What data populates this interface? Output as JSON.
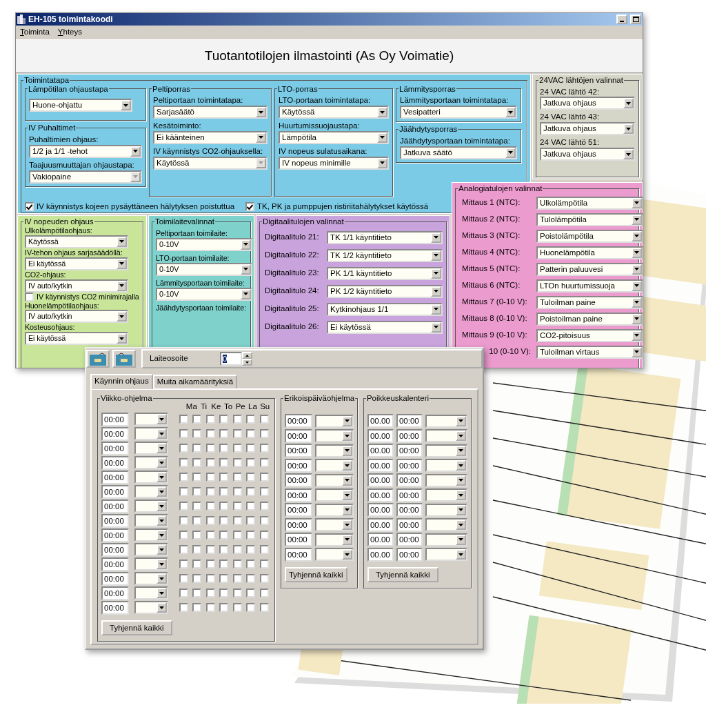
{
  "window": {
    "title": "EH-105 toimintakoodi"
  },
  "menu": [
    "Toiminta",
    "Yhteys"
  ],
  "heading": "Tuotantotilojen ilmastointi (As Oy Voimatie)",
  "toimintatapa": {
    "title": "Toimintatapa",
    "columns": [
      [
        {
          "title": "Lämpötilan ohjaustapa",
          "fields": [
            {
              "value": "Huone-ohjattu",
              "disabled": false
            }
          ]
        },
        {
          "title": "IV Puhaltimet",
          "fields": [
            {
              "label": "Puhaltimien ohjaus:",
              "value": "1/2 ja 1/1 -tehot",
              "disabled": false
            },
            {
              "label": "Taajuusmuuttajan ohjaustapa:",
              "value": "Vakiopaine",
              "disabled": true
            }
          ]
        }
      ],
      [
        {
          "title": "Peltiporras",
          "fields": [
            {
              "label": "Peltiportaan toimintatapa:",
              "value": "Sarjasäätö",
              "disabled": false
            },
            {
              "label": "Kesätoiminto:",
              "value": "Ei käänteinen",
              "disabled": false
            },
            {
              "label": "IV käynnistys CO2-ohjauksella:",
              "value": "Käytössä",
              "disabled": true
            }
          ]
        }
      ],
      [
        {
          "title": "LTO-porras",
          "fields": [
            {
              "label": "LTO-portaan toimintatapa:",
              "value": "Käytössä",
              "disabled": false
            },
            {
              "label": "Huurtumissuojaustapa:",
              "value": "Lämpötila",
              "disabled": false
            },
            {
              "label": "IV nopeus sulatusaikana:",
              "value": "IV nopeus minimille",
              "disabled": false
            }
          ]
        }
      ],
      [
        {
          "title": "Lämmitysporras",
          "fields": [
            {
              "label": "Lämmitysportaan toimintatapa:",
              "value": "Vesipatteri",
              "disabled": false
            }
          ]
        },
        {
          "title": "Jäähdytysporras",
          "fields": [
            {
              "label": "Jäähdytysportaan toimintatapa:",
              "value": "Jatkuva säätö",
              "disabled": false
            }
          ]
        }
      ]
    ],
    "checkboxes": [
      {
        "label": "IV käynnistys kojeen pysäyttäneen hälytyksen poistuttua",
        "checked": true
      },
      {
        "label": "TK, PK ja pumppujen ristiriitahälytykset käytössä",
        "checked": true
      }
    ]
  },
  "vac_outputs": {
    "title": "24VAC lähtöjen valinnat",
    "fields": [
      {
        "label": "24 VAC lähtö 42:",
        "value": "Jatkuva ohjaus"
      },
      {
        "label": "24 VAC lähtö 43:",
        "value": "Jatkuva ohjaus"
      },
      {
        "label": "24 VAC lähtö 51:",
        "value": "Jatkuva ohjaus"
      }
    ]
  },
  "fan_speed": {
    "title": "IV nopeuden ohjaus",
    "items": [
      {
        "kind": "select",
        "label": "Ulkolämpötilaohjaus:",
        "value": "Käytössä"
      },
      {
        "kind": "select",
        "label": "IV-tehon ohjaus sarjasäädöllä:",
        "value": "Ei käytössä"
      },
      {
        "kind": "select",
        "label": "CO2-ohjaus:",
        "value": "IV auto/kytkin"
      },
      {
        "kind": "checkbox",
        "label": "IV käynnistys CO2 minimirajalla",
        "checked": false
      },
      {
        "kind": "select",
        "label": "Huonelämpötilaohjaus:",
        "value": "IV auto/kytkin"
      },
      {
        "kind": "select",
        "label": "Kosteusohjaus:",
        "value": "Ei käytössä"
      }
    ]
  },
  "actuators": {
    "title": "Toimilaitevalinnat",
    "fields": [
      {
        "label": "Peltiportaan toimilaite:",
        "value": "0-10V"
      },
      {
        "label": "LTO-portaan toimilaite:",
        "value": "0-10V"
      },
      {
        "label": "Lämmitysportaan toimilaite:",
        "value": "0-10V"
      },
      {
        "label": "Jäähdytysportaan toimilaite:"
      }
    ]
  },
  "digital_inputs": {
    "title": "Digitaalitulojen valinnat",
    "fields": [
      {
        "label": "Digitaalitulo 21:",
        "value": "TK 1/1 käyntitieto"
      },
      {
        "label": "Digitaalitulo 22:",
        "value": "TK 1/2 käyntitieto"
      },
      {
        "label": "Digitaalitulo 23:",
        "value": "PK 1/1 käyntitieto"
      },
      {
        "label": "Digitaalitulo 24:",
        "value": "PK 1/2 käyntitieto"
      },
      {
        "label": "Digitaalitulo 25:",
        "value": "Kytkinohjaus 1/1"
      },
      {
        "label": "Digitaalitulo 26:",
        "value": "Ei käytössä"
      }
    ]
  },
  "analog_inputs": {
    "title": "Analogiatulojen valinnat",
    "fields": [
      {
        "label": "Mittaus 1 (NTC):",
        "value": "Ulkolämpötila"
      },
      {
        "label": "Mittaus 2 (NTC):",
        "value": "Tulolämpötila"
      },
      {
        "label": "Mittaus 3 (NTC):",
        "value": "Poistolämpötila"
      },
      {
        "label": "Mittaus 4 (NTC):",
        "value": "Huonelämpötila"
      },
      {
        "label": "Mittaus 5 (NTC):",
        "value": "Patterin paluuvesi"
      },
      {
        "label": "Mittaus 6 (NTC):",
        "value": "LTOn huurtumissuoja"
      },
      {
        "label": "Mittaus 7 (0-10 V):",
        "value": "Tuloilman paine"
      },
      {
        "label": "Mittaus 8 (0-10 V):",
        "value": "Poistoilman paine"
      },
      {
        "label": "Mittaus 9 (0-10 V):",
        "value": "CO2-pitoisuus"
      },
      {
        "label": "10 (0-10 V):",
        "value": "Tuloilman virtaus"
      }
    ]
  },
  "device_address": {
    "label": "Laiteosoite",
    "value": "0"
  },
  "tabs": [
    {
      "label": "Käynnin ohjaus",
      "selected": true
    },
    {
      "label": "Muita aikamäärityksiä",
      "selected": false
    }
  ],
  "weekly": {
    "title": "Viikko-ohjelma",
    "days": [
      "Ma",
      "Ti",
      "Ke",
      "To",
      "Pe",
      "La",
      "Su"
    ],
    "rows": [
      {
        "time": "00:00",
        "days": [
          false,
          false,
          false,
          false,
          false,
          false,
          false
        ]
      },
      {
        "time": "00:00",
        "days": [
          false,
          false,
          false,
          false,
          false,
          false,
          false
        ]
      },
      {
        "time": "00:00",
        "days": [
          false,
          false,
          false,
          false,
          false,
          false,
          false
        ]
      },
      {
        "time": "00:00",
        "days": [
          false,
          false,
          false,
          false,
          false,
          false,
          false
        ]
      },
      {
        "time": "00:00",
        "days": [
          false,
          false,
          false,
          false,
          false,
          false,
          false
        ]
      },
      {
        "time": "00:00",
        "days": [
          false,
          false,
          false,
          false,
          false,
          false,
          false
        ]
      },
      {
        "time": "00:00",
        "days": [
          false,
          false,
          false,
          false,
          false,
          false,
          false
        ]
      },
      {
        "time": "00:00",
        "days": [
          false,
          false,
          false,
          false,
          false,
          false,
          false
        ]
      },
      {
        "time": "00:00",
        "days": [
          false,
          false,
          false,
          false,
          false,
          false,
          false
        ]
      },
      {
        "time": "00:00",
        "days": [
          false,
          false,
          false,
          false,
          false,
          false,
          false
        ]
      },
      {
        "time": "00:00",
        "days": [
          false,
          false,
          false,
          false,
          false,
          false,
          false
        ]
      },
      {
        "time": "00:00",
        "days": [
          false,
          false,
          false,
          false,
          false,
          false,
          false
        ]
      },
      {
        "time": "00:00",
        "days": [
          false,
          false,
          false,
          false,
          false,
          false,
          false
        ]
      },
      {
        "time": "00:00",
        "days": [
          false,
          false,
          false,
          false,
          false,
          false,
          false
        ]
      }
    ],
    "button": "Tyhjennä kaikki"
  },
  "special_days": {
    "title": "Erikoispäiväohjelma",
    "rows": [
      {
        "time": "00:00"
      },
      {
        "time": "00:00"
      },
      {
        "time": "00:00"
      },
      {
        "time": "00:00"
      },
      {
        "time": "00:00"
      },
      {
        "time": "00:00"
      },
      {
        "time": "00:00"
      },
      {
        "time": "00:00"
      },
      {
        "time": "00:00"
      },
      {
        "time": "00:00"
      }
    ],
    "button": "Tyhjennä kaikki"
  },
  "exceptions": {
    "title": "Poikkeuskalenteri",
    "rows": [
      {
        "date": "00.00",
        "time": "00:00"
      },
      {
        "date": "00.00",
        "time": "00:00"
      },
      {
        "date": "00.00",
        "time": "00:00"
      },
      {
        "date": "00.00",
        "time": "00:00"
      },
      {
        "date": "00.00",
        "time": "00:00"
      },
      {
        "date": "00.00",
        "time": "00:00"
      },
      {
        "date": "00.00",
        "time": "00:00"
      },
      {
        "date": "00.00",
        "time": "00:00"
      },
      {
        "date": "00.00",
        "time": "00:00"
      },
      {
        "date": "00.00",
        "time": "00:00"
      }
    ],
    "button": "Tyhjennä kaikki"
  }
}
